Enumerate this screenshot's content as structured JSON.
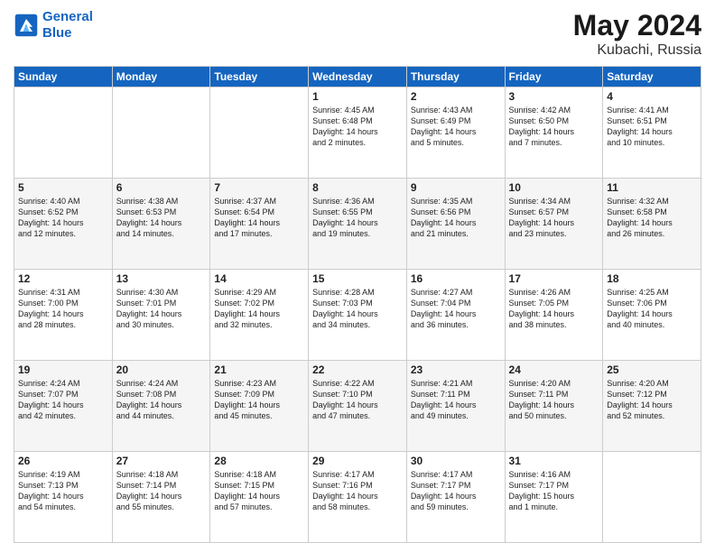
{
  "header": {
    "logo_line1": "General",
    "logo_line2": "Blue",
    "month": "May 2024",
    "location": "Kubachi, Russia"
  },
  "weekdays": [
    "Sunday",
    "Monday",
    "Tuesday",
    "Wednesday",
    "Thursday",
    "Friday",
    "Saturday"
  ],
  "rows": [
    {
      "shaded": false,
      "cells": [
        {
          "day": "",
          "info": ""
        },
        {
          "day": "",
          "info": ""
        },
        {
          "day": "",
          "info": ""
        },
        {
          "day": "1",
          "info": "Sunrise: 4:45 AM\nSunset: 6:48 PM\nDaylight: 14 hours\nand 2 minutes."
        },
        {
          "day": "2",
          "info": "Sunrise: 4:43 AM\nSunset: 6:49 PM\nDaylight: 14 hours\nand 5 minutes."
        },
        {
          "day": "3",
          "info": "Sunrise: 4:42 AM\nSunset: 6:50 PM\nDaylight: 14 hours\nand 7 minutes."
        },
        {
          "day": "4",
          "info": "Sunrise: 4:41 AM\nSunset: 6:51 PM\nDaylight: 14 hours\nand 10 minutes."
        }
      ]
    },
    {
      "shaded": true,
      "cells": [
        {
          "day": "5",
          "info": "Sunrise: 4:40 AM\nSunset: 6:52 PM\nDaylight: 14 hours\nand 12 minutes."
        },
        {
          "day": "6",
          "info": "Sunrise: 4:38 AM\nSunset: 6:53 PM\nDaylight: 14 hours\nand 14 minutes."
        },
        {
          "day": "7",
          "info": "Sunrise: 4:37 AM\nSunset: 6:54 PM\nDaylight: 14 hours\nand 17 minutes."
        },
        {
          "day": "8",
          "info": "Sunrise: 4:36 AM\nSunset: 6:55 PM\nDaylight: 14 hours\nand 19 minutes."
        },
        {
          "day": "9",
          "info": "Sunrise: 4:35 AM\nSunset: 6:56 PM\nDaylight: 14 hours\nand 21 minutes."
        },
        {
          "day": "10",
          "info": "Sunrise: 4:34 AM\nSunset: 6:57 PM\nDaylight: 14 hours\nand 23 minutes."
        },
        {
          "day": "11",
          "info": "Sunrise: 4:32 AM\nSunset: 6:58 PM\nDaylight: 14 hours\nand 26 minutes."
        }
      ]
    },
    {
      "shaded": false,
      "cells": [
        {
          "day": "12",
          "info": "Sunrise: 4:31 AM\nSunset: 7:00 PM\nDaylight: 14 hours\nand 28 minutes."
        },
        {
          "day": "13",
          "info": "Sunrise: 4:30 AM\nSunset: 7:01 PM\nDaylight: 14 hours\nand 30 minutes."
        },
        {
          "day": "14",
          "info": "Sunrise: 4:29 AM\nSunset: 7:02 PM\nDaylight: 14 hours\nand 32 minutes."
        },
        {
          "day": "15",
          "info": "Sunrise: 4:28 AM\nSunset: 7:03 PM\nDaylight: 14 hours\nand 34 minutes."
        },
        {
          "day": "16",
          "info": "Sunrise: 4:27 AM\nSunset: 7:04 PM\nDaylight: 14 hours\nand 36 minutes."
        },
        {
          "day": "17",
          "info": "Sunrise: 4:26 AM\nSunset: 7:05 PM\nDaylight: 14 hours\nand 38 minutes."
        },
        {
          "day": "18",
          "info": "Sunrise: 4:25 AM\nSunset: 7:06 PM\nDaylight: 14 hours\nand 40 minutes."
        }
      ]
    },
    {
      "shaded": true,
      "cells": [
        {
          "day": "19",
          "info": "Sunrise: 4:24 AM\nSunset: 7:07 PM\nDaylight: 14 hours\nand 42 minutes."
        },
        {
          "day": "20",
          "info": "Sunrise: 4:24 AM\nSunset: 7:08 PM\nDaylight: 14 hours\nand 44 minutes."
        },
        {
          "day": "21",
          "info": "Sunrise: 4:23 AM\nSunset: 7:09 PM\nDaylight: 14 hours\nand 45 minutes."
        },
        {
          "day": "22",
          "info": "Sunrise: 4:22 AM\nSunset: 7:10 PM\nDaylight: 14 hours\nand 47 minutes."
        },
        {
          "day": "23",
          "info": "Sunrise: 4:21 AM\nSunset: 7:11 PM\nDaylight: 14 hours\nand 49 minutes."
        },
        {
          "day": "24",
          "info": "Sunrise: 4:20 AM\nSunset: 7:11 PM\nDaylight: 14 hours\nand 50 minutes."
        },
        {
          "day": "25",
          "info": "Sunrise: 4:20 AM\nSunset: 7:12 PM\nDaylight: 14 hours\nand 52 minutes."
        }
      ]
    },
    {
      "shaded": false,
      "cells": [
        {
          "day": "26",
          "info": "Sunrise: 4:19 AM\nSunset: 7:13 PM\nDaylight: 14 hours\nand 54 minutes."
        },
        {
          "day": "27",
          "info": "Sunrise: 4:18 AM\nSunset: 7:14 PM\nDaylight: 14 hours\nand 55 minutes."
        },
        {
          "day": "28",
          "info": "Sunrise: 4:18 AM\nSunset: 7:15 PM\nDaylight: 14 hours\nand 57 minutes."
        },
        {
          "day": "29",
          "info": "Sunrise: 4:17 AM\nSunset: 7:16 PM\nDaylight: 14 hours\nand 58 minutes."
        },
        {
          "day": "30",
          "info": "Sunrise: 4:17 AM\nSunset: 7:17 PM\nDaylight: 14 hours\nand 59 minutes."
        },
        {
          "day": "31",
          "info": "Sunrise: 4:16 AM\nSunset: 7:17 PM\nDaylight: 15 hours\nand 1 minute."
        },
        {
          "day": "",
          "info": ""
        }
      ]
    }
  ]
}
